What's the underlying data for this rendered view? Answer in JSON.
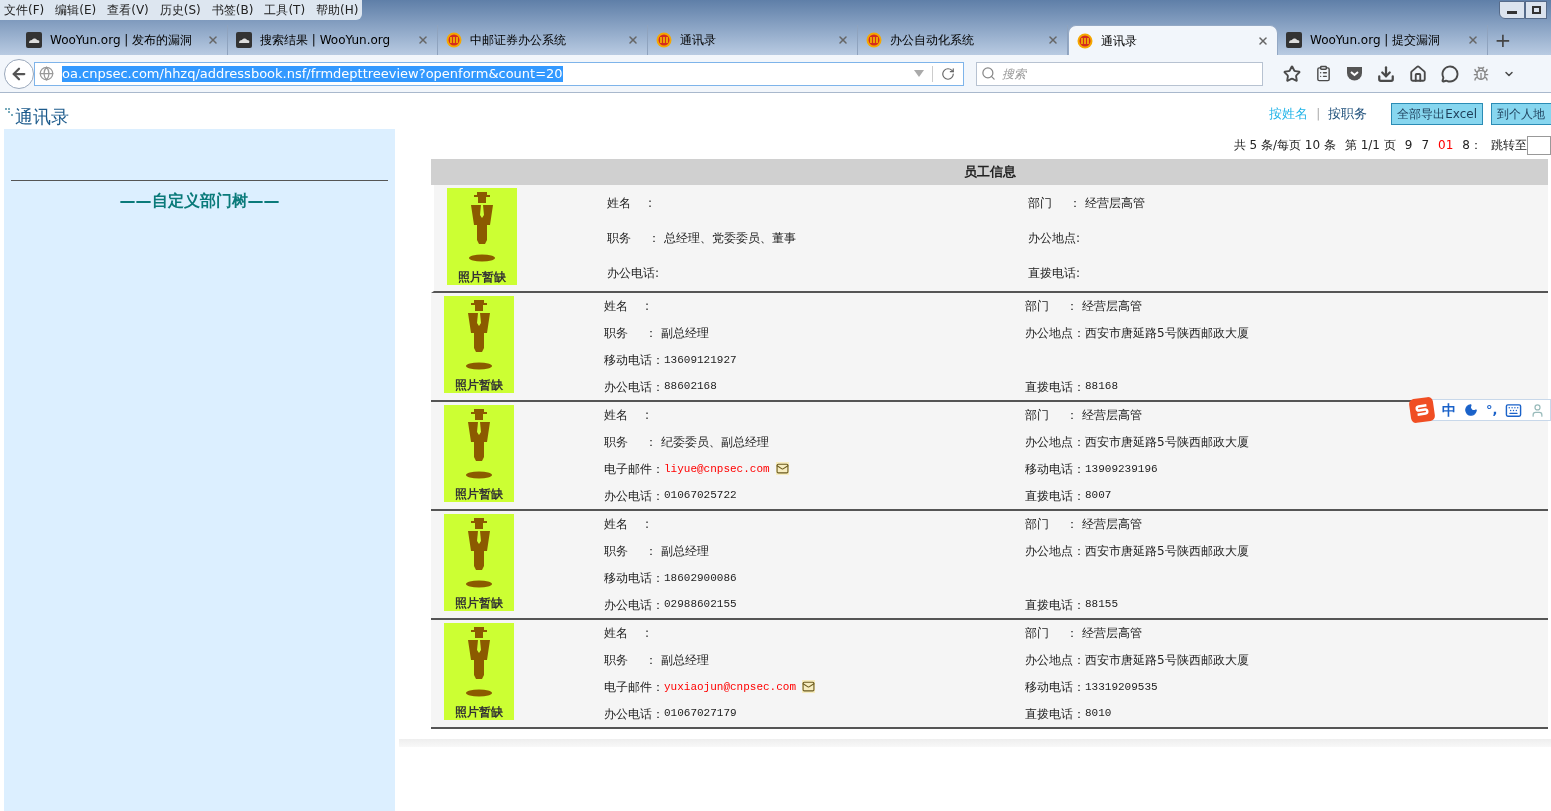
{
  "menu_bar": [
    "文件(F)",
    "编辑(E)",
    "查看(V)",
    "历史(S)",
    "书签(B)",
    "工具(T)",
    "帮助(H)"
  ],
  "tabs": [
    {
      "label": "WooYun.org | 发布的漏洞",
      "kind": "cloud",
      "selected": false
    },
    {
      "label": "搜索结果 | WooYun.org",
      "kind": "cloud",
      "selected": false
    },
    {
      "label": "中邮证券办公系统",
      "kind": "emblem",
      "selected": false
    },
    {
      "label": "通讯录",
      "kind": "emblem",
      "selected": false
    },
    {
      "label": "办公自动化系统",
      "kind": "emblem",
      "selected": false
    },
    {
      "label": "通讯录",
      "kind": "emblem",
      "selected": true
    },
    {
      "label": "WooYun.org | 提交漏洞",
      "kind": "cloud",
      "selected": false
    }
  ],
  "new_tab": "+",
  "address_bar": {
    "url": "oa.cnpsec.com/hhzq/addressbook.nsf/frmdepttreeview?openform&count=20"
  },
  "search": {
    "placeholder": "搜索"
  },
  "page": {
    "title": "通讯录",
    "tree_title": "——自定义部门树——",
    "sort_links": [
      {
        "label": "按姓名",
        "selected": true
      },
      {
        "label": "按职务",
        "selected": false
      }
    ],
    "sort_separator": "|",
    "buttons": [
      "全部导出Excel",
      "到个人地"
    ],
    "pagination": [
      {
        "text": "共 5 条/每页 10 条"
      },
      {
        "text": "第 1/1 页"
      },
      {
        "text": "9",
        "color": "#222222"
      },
      {
        "text": "7",
        "color": "#222222"
      },
      {
        "text": "01",
        "color": "#ff0000"
      },
      {
        "text": "8：",
        "color": "#222222"
      },
      {
        "text": "跳转至"
      }
    ],
    "table_title": "员工信息",
    "employees": [
      {
        "photo_caption": "照片暂缺",
        "rows": [
          {
            "left": {
              "label": "姓名",
              "sep": ":",
              "kind": "text"
            },
            "right": {
              "label": "部门",
              "sep": "：",
              "value": "经营层高管",
              "kind": "text"
            }
          },
          {
            "left": {
              "label": "职务",
              "sep": "：",
              "value": "总经理、党委委员、董事",
              "kind": "text"
            },
            "right": {
              "label": "办公地点:",
              "kind": "text"
            }
          },
          {
            "left": {
              "label": "办公电话:",
              "kind": "text"
            },
            "right": {
              "label": "直拨电话:",
              "kind": "text"
            }
          }
        ]
      },
      {
        "photo_caption": "照片暂缺",
        "rows": [
          {
            "left": {
              "label": "姓名",
              "sep": ":",
              "kind": "text"
            },
            "right": {
              "label": "部门",
              "sep": "：",
              "value": "经营层高管",
              "kind": "text"
            }
          },
          {
            "left": {
              "label": "职务",
              "sep": "：",
              "value": "副总经理",
              "kind": "text"
            },
            "right": {
              "label": "办公地点：",
              "value": "西安市唐延路5号陕西邮政大厦",
              "kind": "text"
            }
          },
          {
            "left": {
              "label": "移动电话：",
              "value": "13609121927",
              "kind": "phone"
            }
          },
          {
            "left": {
              "label": "办公电话：",
              "value": "88602168",
              "kind": "phone"
            },
            "right": {
              "label": "直拨电话：",
              "value": "88168",
              "kind": "phone"
            }
          }
        ]
      },
      {
        "photo_caption": "照片暂缺",
        "rows": [
          {
            "left": {
              "label": "姓名",
              "sep": ":",
              "kind": "text"
            },
            "right": {
              "label": "部门",
              "sep": "：",
              "value": "经营层高管",
              "kind": "text"
            }
          },
          {
            "left": {
              "label": "职务",
              "sep": "：",
              "value": "纪委委员、副总经理",
              "kind": "text"
            },
            "right": {
              "label": "办公地点：",
              "value": "西安市唐延路5号陕西邮政大厦",
              "kind": "text"
            }
          },
          {
            "left": {
              "label": "电子邮件：",
              "value": "liyue@cnpsec.com",
              "kind": "email"
            },
            "right": {
              "label": "移动电话：",
              "value": "13909239196",
              "kind": "phone"
            }
          },
          {
            "left": {
              "label": "办公电话：",
              "value": "01067025722",
              "kind": "phone"
            },
            "right": {
              "label": "直拨电话：",
              "value": "8007",
              "kind": "phone"
            }
          }
        ]
      },
      {
        "photo_caption": "照片暂缺",
        "rows": [
          {
            "left": {
              "label": "姓名",
              "sep": ":",
              "kind": "text"
            },
            "right": {
              "label": "部门",
              "sep": "：",
              "value": "经营层高管",
              "kind": "text"
            }
          },
          {
            "left": {
              "label": "职务",
              "sep": "：",
              "value": "副总经理",
              "kind": "text"
            },
            "right": {
              "label": "办公地点：",
              "value": "西安市唐延路5号陕西邮政大厦",
              "kind": "text"
            }
          },
          {
            "left": {
              "label": "移动电话：",
              "value": "18602900086",
              "kind": "phone"
            }
          },
          {
            "left": {
              "label": "办公电话：",
              "value": "02988602155",
              "kind": "phone"
            },
            "right": {
              "label": "直拨电话：",
              "value": "88155",
              "kind": "phone"
            }
          }
        ]
      },
      {
        "photo_caption": "照片暂缺",
        "rows": [
          {
            "left": {
              "label": "姓名",
              "sep": ":",
              "kind": "text"
            },
            "right": {
              "label": "部门",
              "sep": "：",
              "value": "经营层高管",
              "kind": "text"
            }
          },
          {
            "left": {
              "label": "职务",
              "sep": "：",
              "value": "副总经理",
              "kind": "text"
            },
            "right": {
              "label": "办公地点：",
              "value": "西安市唐延路5号陕西邮政大厦",
              "kind": "text"
            }
          },
          {
            "left": {
              "label": "电子邮件：",
              "value": "yuxiaojun@cnpsec.com",
              "kind": "email"
            },
            "right": {
              "label": "移动电话：",
              "value": "13319209535",
              "kind": "phone"
            }
          },
          {
            "left": {
              "label": "办公电话：",
              "value": "01067027179",
              "kind": "phone"
            },
            "right": {
              "label": "直拨电话：",
              "value": "8010",
              "kind": "phone"
            }
          }
        ]
      }
    ]
  },
  "ime_toolbar": {
    "mode": "中",
    "punctuation": "°,"
  }
}
